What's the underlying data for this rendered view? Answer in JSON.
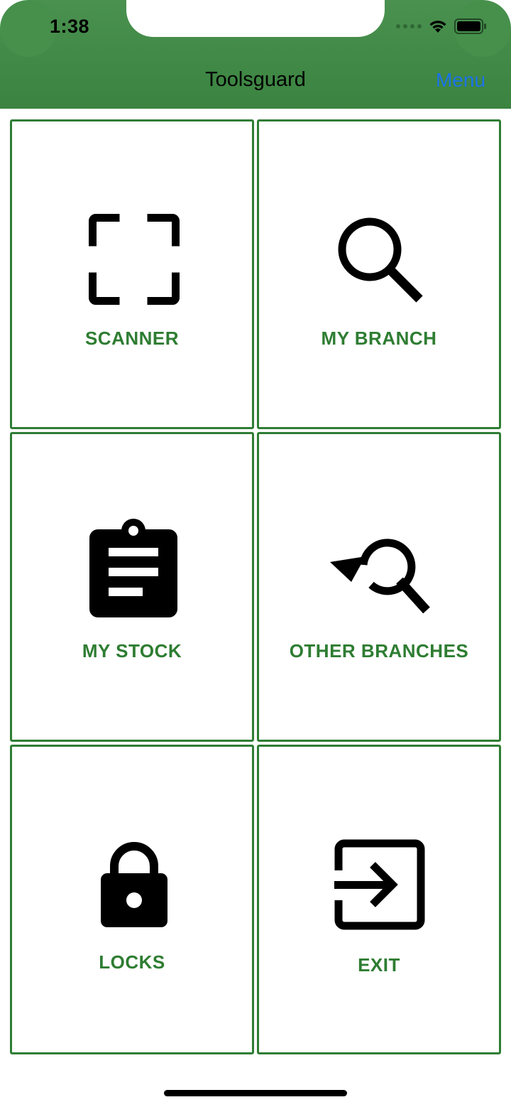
{
  "status_bar": {
    "time": "1:38"
  },
  "nav": {
    "title": "Toolsguard",
    "menu_label": "Menu"
  },
  "tiles": [
    {
      "label": "SCANNER",
      "icon": "scanner-icon"
    },
    {
      "label": "MY BRANCH",
      "icon": "search-icon"
    },
    {
      "label": "MY STOCK",
      "icon": "clipboard-icon"
    },
    {
      "label": "OTHER BRANCHES",
      "icon": "search-history-icon"
    },
    {
      "label": "LOCKS",
      "icon": "lock-icon"
    },
    {
      "label": "EXIT",
      "icon": "exit-icon"
    }
  ],
  "colors": {
    "header": "#3f8a45",
    "accent": "#2e7d32",
    "link": "#1a73e8"
  }
}
